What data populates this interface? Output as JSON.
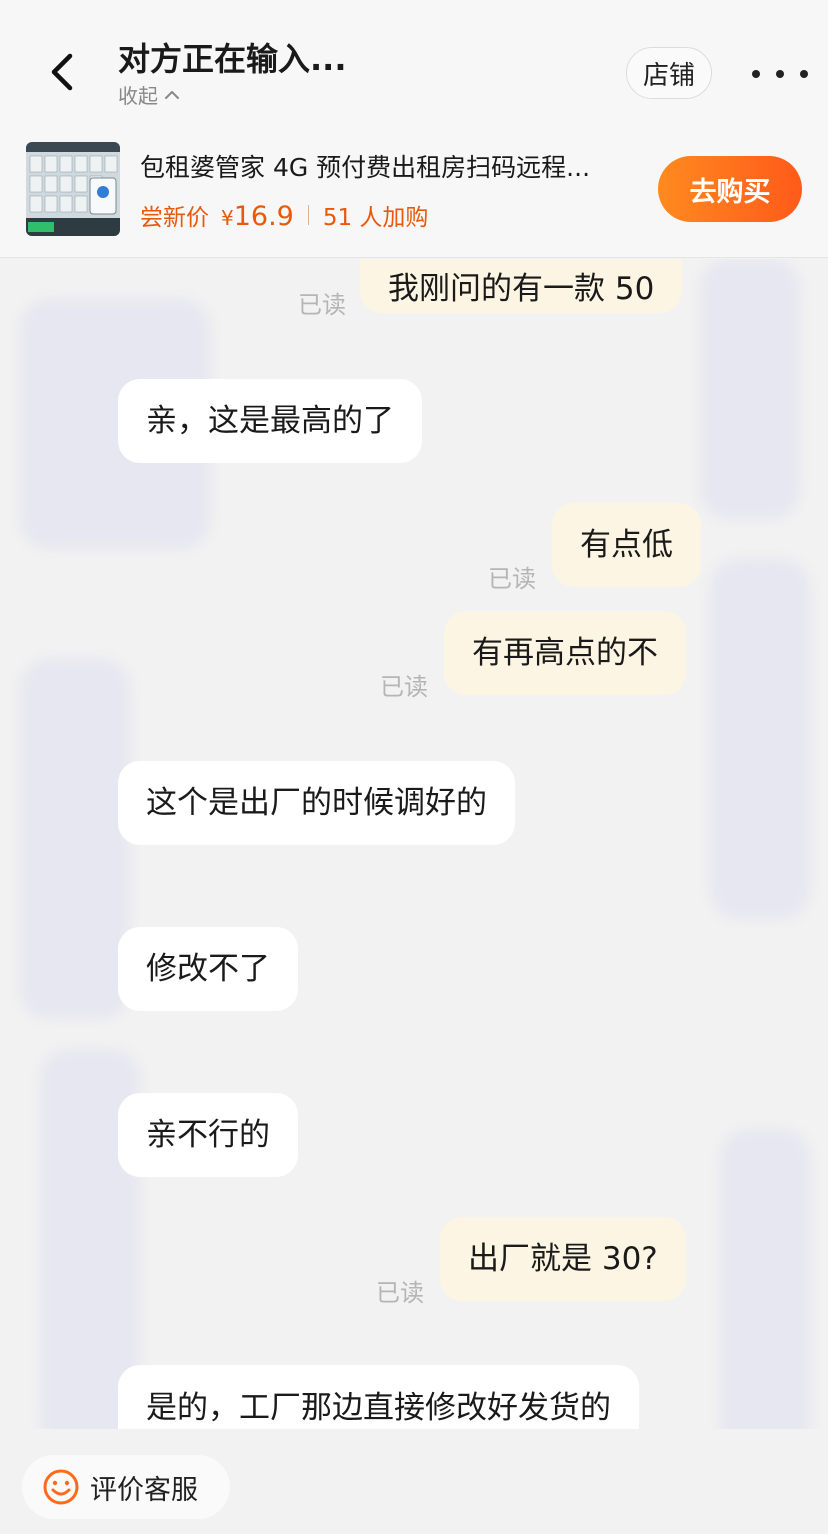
{
  "header": {
    "title": "对方正在输入...",
    "collapse_label": "收起",
    "shop_label": "店铺"
  },
  "product": {
    "name": "包租婆管家 4G 预付费出租房扫码远程...",
    "price_tag": "尝新价",
    "currency": "¥",
    "price": "16.9",
    "cart_count": "51 人加购",
    "buy_label": "去购买"
  },
  "messages": [
    {
      "side": "out",
      "text": "我刚问的有一款 50",
      "read": "已读"
    },
    {
      "side": "in",
      "text": "亲，这是最高的了"
    },
    {
      "side": "out",
      "text": "有点低",
      "read": "已读"
    },
    {
      "side": "out",
      "text": "有再高点的不",
      "read": "已读"
    },
    {
      "side": "in",
      "text": "这个是出厂的时候调好的"
    },
    {
      "side": "in",
      "text": "修改不了"
    },
    {
      "side": "in",
      "text": "亲不行的"
    },
    {
      "side": "out",
      "text": "出厂就是 30?",
      "read": "已读"
    },
    {
      "side": "in",
      "text": "是的，工厂那边直接修改好发货的"
    }
  ],
  "footer": {
    "rate_label": "评价客服"
  },
  "colors": {
    "accent": "#ff6a1a",
    "price": "#e8590c",
    "outgoing_bubble": "#fdf5e3",
    "incoming_bubble": "#ffffff"
  }
}
